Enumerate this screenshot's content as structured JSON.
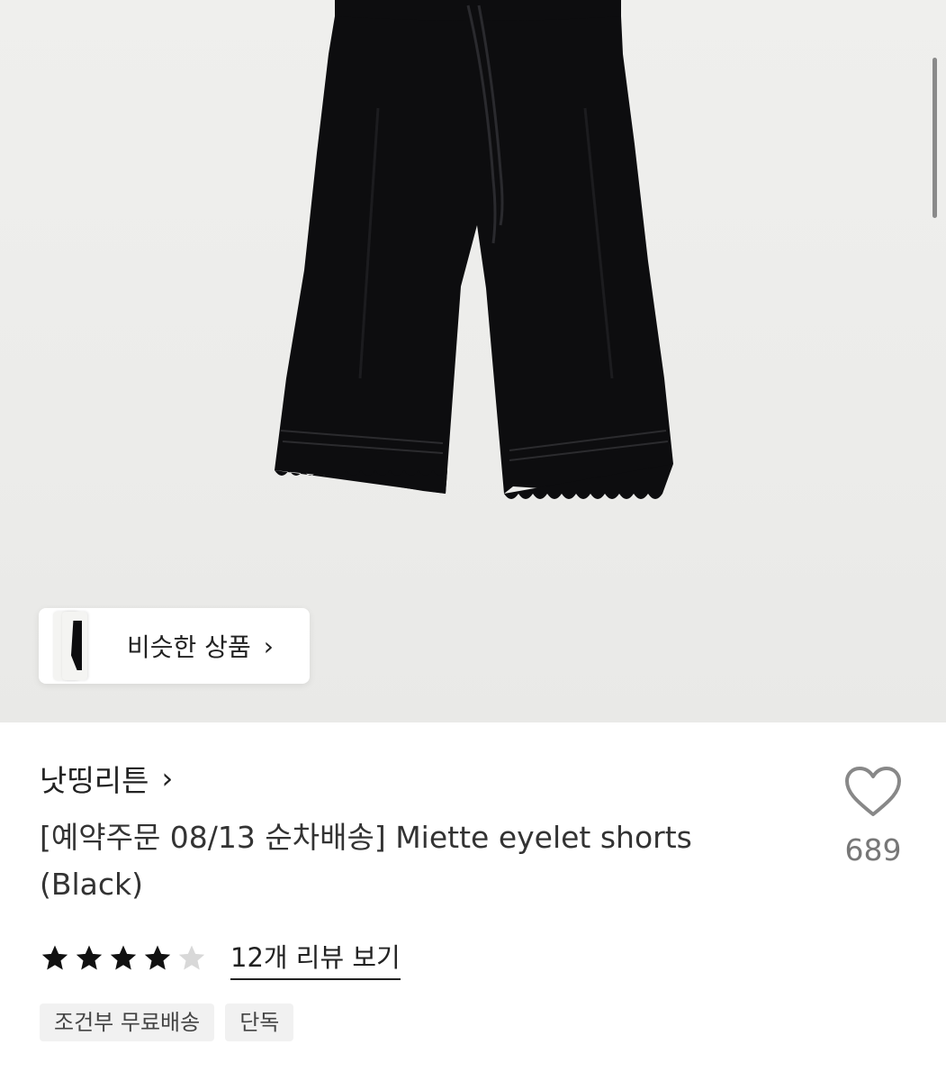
{
  "colors": {
    "hero_bg": "#ecebe9",
    "product": "#0d0d0f",
    "text": "#222222",
    "muted": "#777777",
    "badge_bg": "#f1f1f1"
  },
  "similar": {
    "label": "비슷한 상품",
    "chevron": "›",
    "icon": "chevron-right-icon"
  },
  "brand": {
    "name": "낫띵리튼",
    "chevron": "›"
  },
  "product": {
    "title": "[예약주문 08/13 순차배송] Miette eyelet shorts (Black)"
  },
  "like": {
    "icon": "heart-outline-icon",
    "count": "689"
  },
  "rating": {
    "value": 4,
    "max": 5,
    "review_link": "12개 리뷰 보기"
  },
  "badges": [
    "조건부 무료배송",
    "단독"
  ]
}
